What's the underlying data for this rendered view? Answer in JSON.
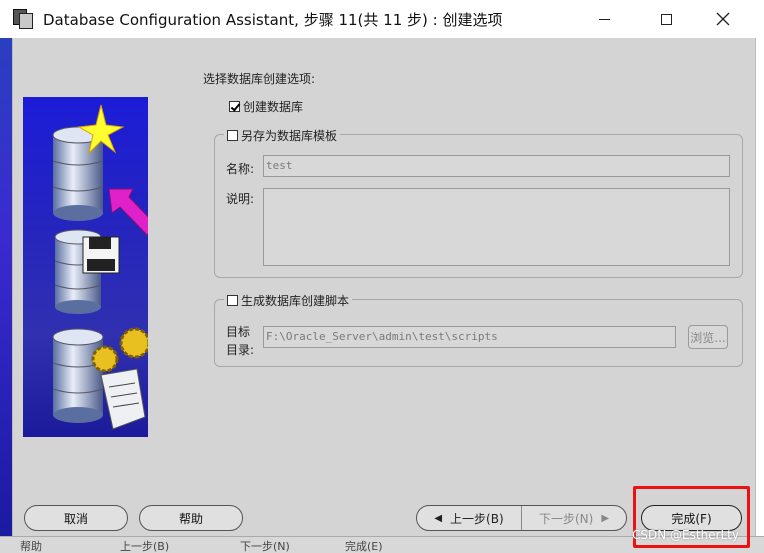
{
  "window": {
    "title": "Database Configuration Assistant, 步骤 11(共 11 步) : 创建选项"
  },
  "form": {
    "prompt": "选择数据库创建选项:",
    "create_db_label": "创建数据库",
    "create_db_checked": true,
    "save_template_label": "另存为数据库模板",
    "save_template_checked": false,
    "name_label": "名称:",
    "name_value": "test",
    "desc_label": "说明:",
    "desc_value": "",
    "gen_scripts_label": "生成数据库创建脚本",
    "gen_scripts_checked": false,
    "target_label_1": "目标",
    "target_label_2": "目录:",
    "target_value": "F:\\Oracle_Server\\admin\\test\\scripts",
    "browse_label": "浏览..."
  },
  "buttons": {
    "cancel": "取消",
    "help": "帮助",
    "back": "上一步(B)",
    "next": "下一步(N)",
    "finish": "完成(F)"
  },
  "background": {
    "bottom_left": "帮助",
    "bottom_mid1": "上一步(B)",
    "bottom_mid2": "下一步(N)",
    "bottom_right": "完成(E)"
  },
  "watermark": "CSDN @EstherLty",
  "colors": {
    "dialog_bg": "#d4d4d4",
    "highlight": "#ee1111",
    "side_image_blue": "#2424c0"
  }
}
